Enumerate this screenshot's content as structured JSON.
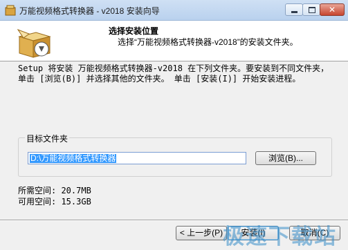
{
  "window": {
    "title": "万能视频格式转换器 - v2018 安装向导",
    "close_glyph": "✕"
  },
  "header": {
    "title": "选择安装位置",
    "subtitle": "选择“万能视频格式转换器-v2018”的安装文件夹。"
  },
  "content": {
    "description": "Setup 将安装 万能视频格式转换器-v2018 在下列文件夹。要安装到不同文件夹，单击 [浏览(B)] 并选择其他的文件夹。 单击 [安装(I)] 开始安装进程。",
    "group_label": "目标文件夹",
    "path_value": "D:\\万能视频格式转换器",
    "browse_label": "浏览(B)...",
    "space_required": "所需空间: 20.7MB",
    "space_available": "可用空间: 15.3GB"
  },
  "footer": {
    "back_label": "< 上一步(P)",
    "install_label": "安装(I)",
    "cancel_label": "取消(C)"
  },
  "watermark": "极速下载站",
  "colors": {
    "accent": "#3399ff",
    "titlebar": "#b9d1ee"
  }
}
